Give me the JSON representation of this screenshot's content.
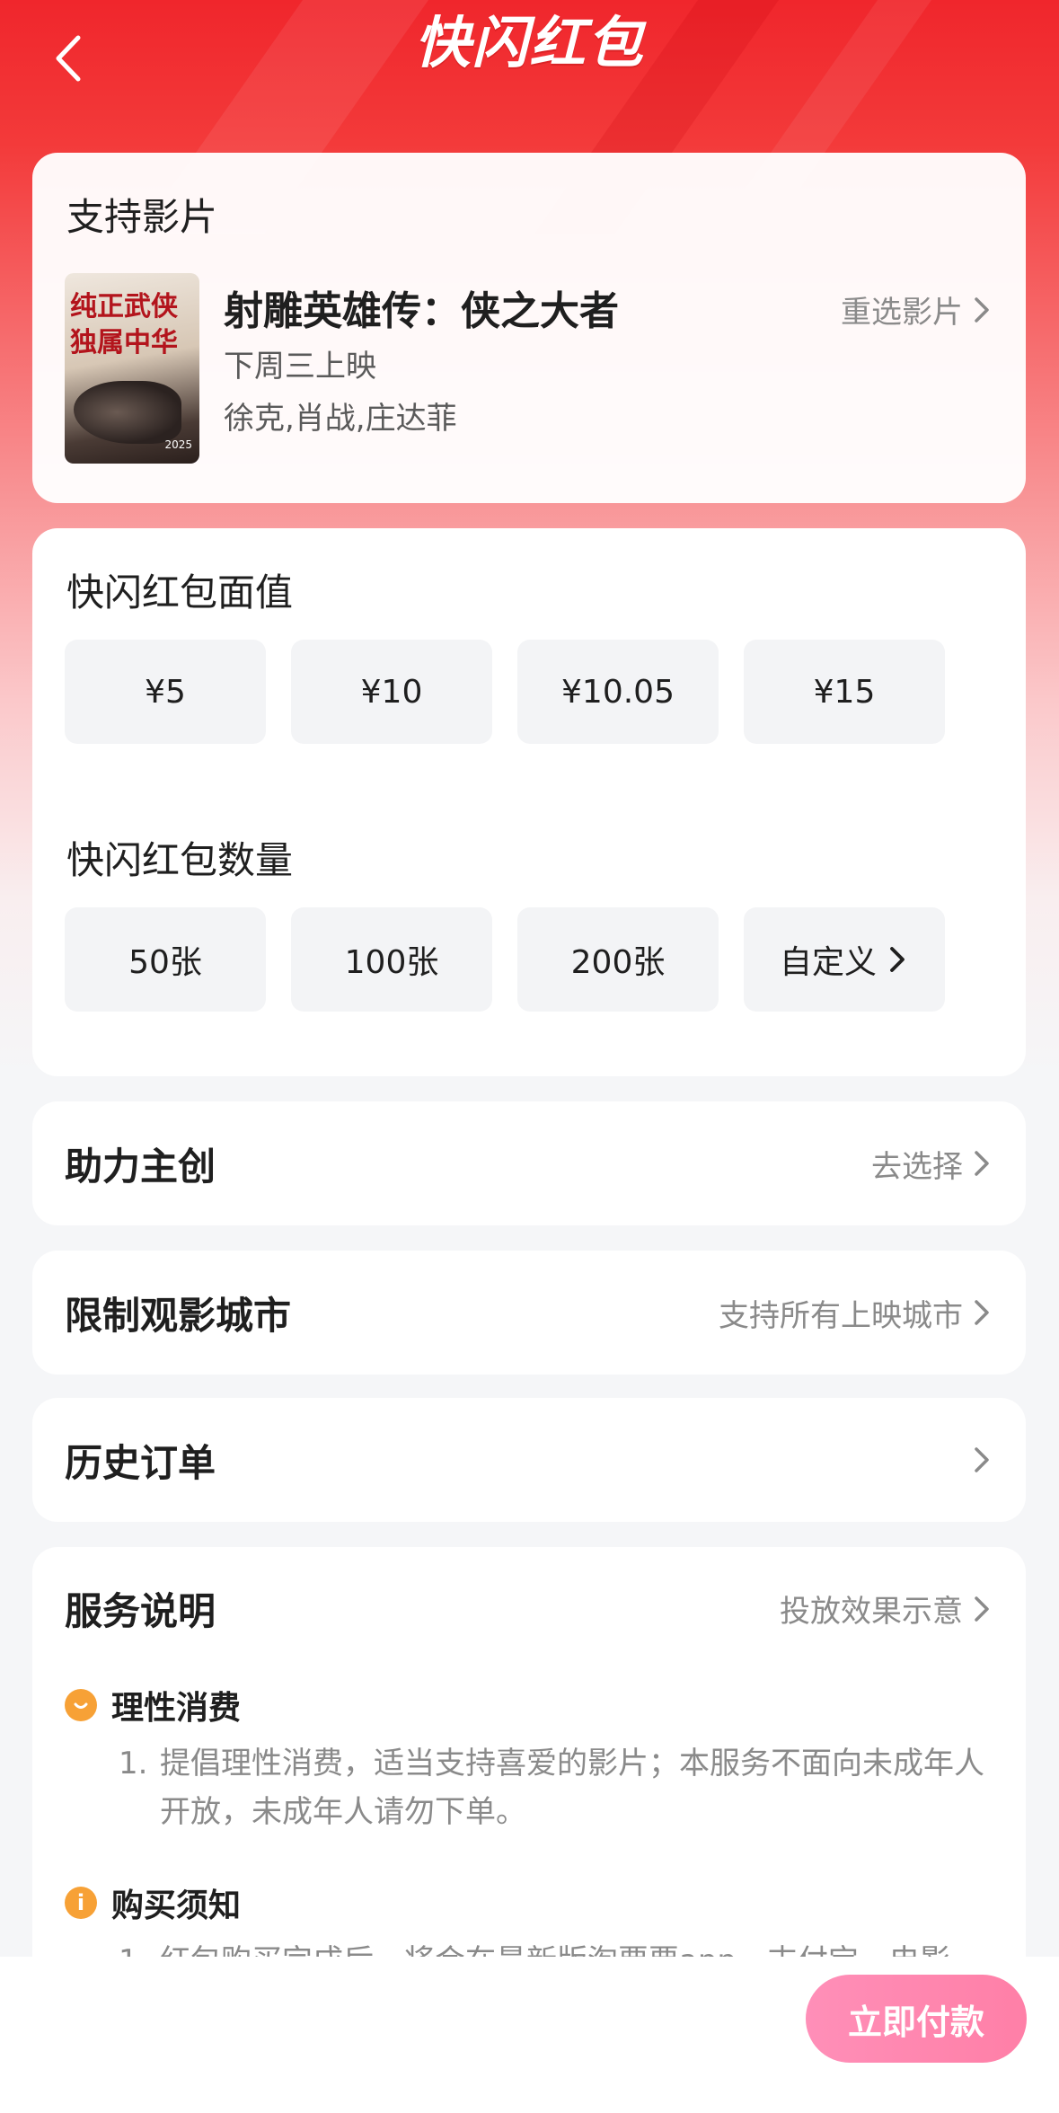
{
  "header": {
    "title": "快闪红包"
  },
  "movie": {
    "section_title": "支持影片",
    "name": "射雕英雄传：侠之大者",
    "release": "下周三上映",
    "cast": "徐克,肖战,庄达菲",
    "reselect_label": "重选影片",
    "poster": {
      "headline": "纯正武侠 独属中华",
      "year": "2025"
    }
  },
  "face_value": {
    "title": "快闪红包面值",
    "options": [
      "¥5",
      "¥10",
      "¥10.05",
      "¥15"
    ]
  },
  "quantity": {
    "title": "快闪红包数量",
    "options": [
      "50张",
      "100张",
      "200张"
    ],
    "custom_label": "自定义"
  },
  "help": {
    "title": "助力主创",
    "action": "去选择"
  },
  "city": {
    "title": "限制观影城市",
    "value": "支持所有上映城市"
  },
  "history": {
    "title": "历史订单"
  },
  "service": {
    "title": "服务说明",
    "link": "投放效果示意",
    "sections": [
      {
        "title": "理性消费",
        "icon": "smile-icon",
        "num": "1.",
        "text": "提倡理性消费，适当支持喜爱的影片；本服务不面向未成年人开放，未成年人请勿下单。"
      },
      {
        "title": "购买须知",
        "icon": "info-icon",
        "num": "1.",
        "text": "红包购买完成后，将会在最新版淘票票app、支付宝、电影"
      }
    ]
  },
  "footer": {
    "pay_label": "立即付款"
  },
  "colors": {
    "brand_red": "#f0262c",
    "pay_pink": "#ff8fb8",
    "badge_orange": "#f7a136"
  }
}
